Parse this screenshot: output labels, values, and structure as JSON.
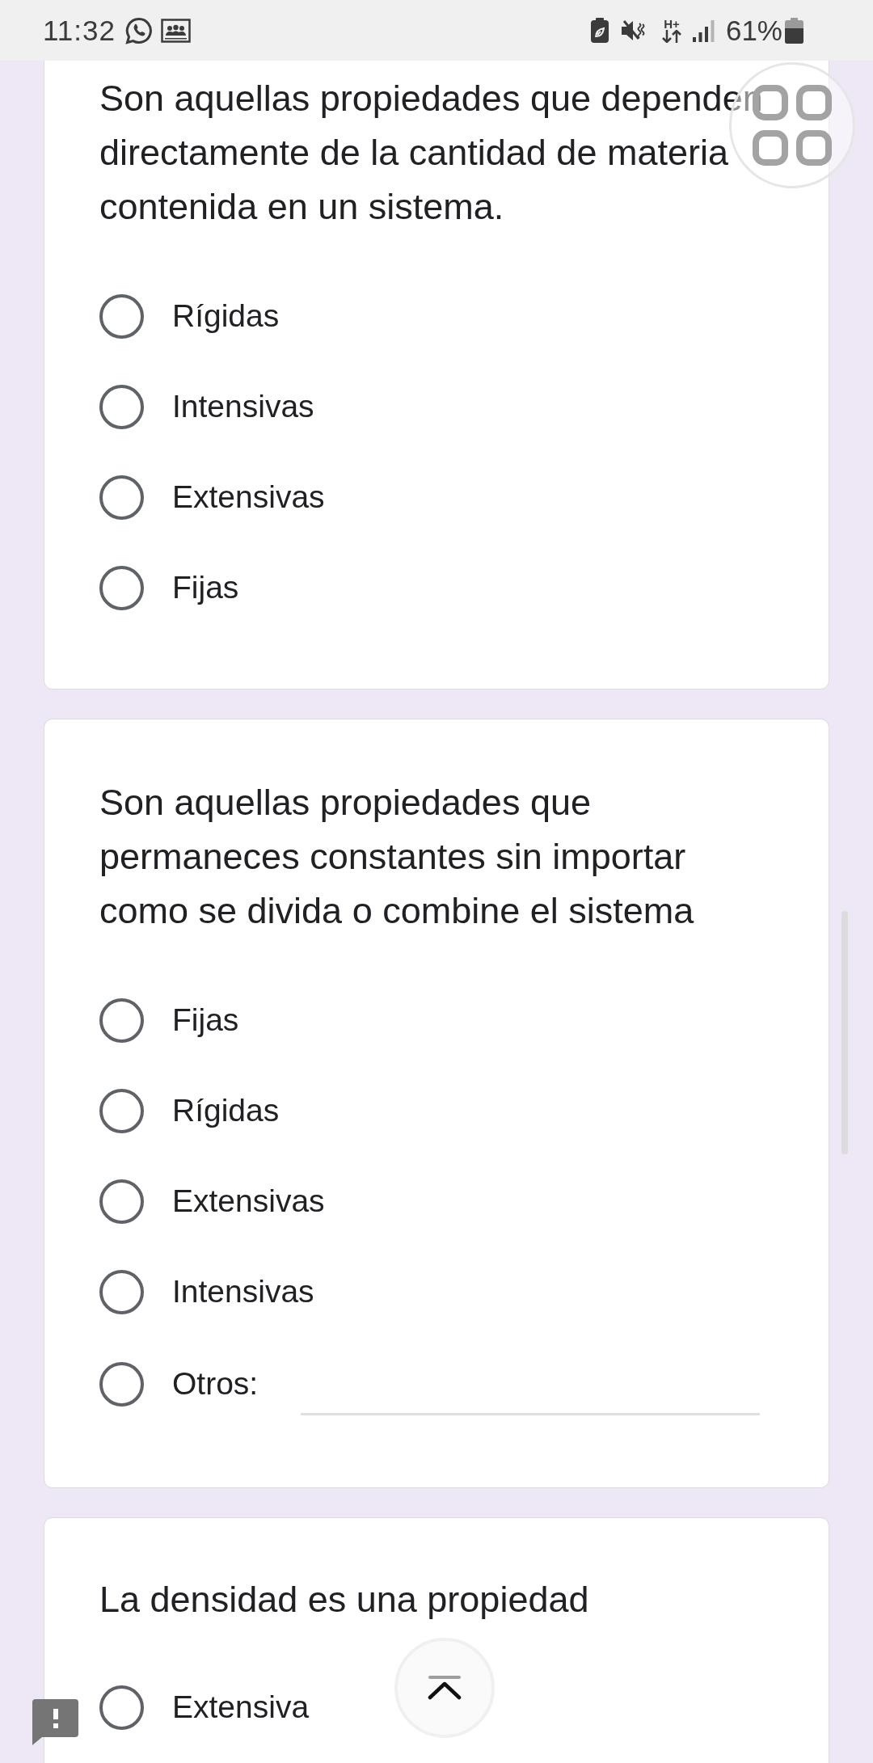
{
  "status_bar": {
    "time": "11:32",
    "network_type": "H+",
    "battery": "61%"
  },
  "questions": [
    {
      "text": "Son aquellas propiedades que dependen directamente de la cantidad de materia contenida en un sistema.",
      "options": [
        {
          "kind": "choice",
          "label": "Rígidas",
          "selected": false
        },
        {
          "kind": "choice",
          "label": "Intensivas",
          "selected": false
        },
        {
          "kind": "choice",
          "label": "Extensivas",
          "selected": false
        },
        {
          "kind": "choice",
          "label": "Fijas",
          "selected": false
        }
      ]
    },
    {
      "text": "Son aquellas propiedades que permaneces constantes sin importar como se divida o combine el sistema",
      "options": [
        {
          "kind": "choice",
          "label": "Fijas",
          "selected": false
        },
        {
          "kind": "choice",
          "label": "Rígidas",
          "selected": false
        },
        {
          "kind": "choice",
          "label": "Extensivas",
          "selected": false
        },
        {
          "kind": "choice",
          "label": "Intensivas",
          "selected": false
        },
        {
          "kind": "other",
          "label": "Otros:",
          "selected": false
        }
      ]
    },
    {
      "text": "La densidad es una propiedad",
      "options": [
        {
          "kind": "choice",
          "label": "Extensiva",
          "selected": false
        }
      ]
    }
  ]
}
